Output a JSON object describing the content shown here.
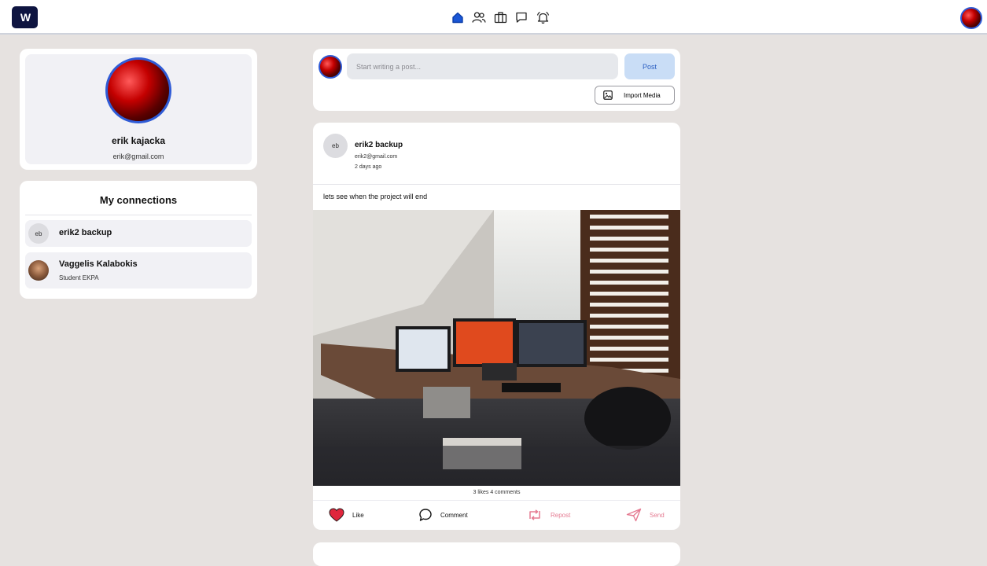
{
  "header": {
    "logo_text": "W",
    "nav": [
      {
        "icon": "home-icon",
        "active": true
      },
      {
        "icon": "people-icon"
      },
      {
        "icon": "briefcase-icon"
      },
      {
        "icon": "chat-icon"
      },
      {
        "icon": "bell-icon"
      }
    ]
  },
  "profile": {
    "name": "erik kajacka",
    "email": "erik@gmail.com"
  },
  "connections": {
    "title": "My connections",
    "items": [
      {
        "initials": "eb",
        "name": "erik2 backup",
        "subtitle": ""
      },
      {
        "initials": "",
        "name": "Vaggelis Kalabokis",
        "subtitle": "Student EKPA"
      }
    ]
  },
  "composer": {
    "placeholder": "Start writing a post...",
    "post_label": "Post",
    "import_media_label": "Import Media"
  },
  "post": {
    "initials": "eb",
    "author": "erik2 backup",
    "email": "erik2@gmail.com",
    "time": "2 days ago",
    "text": "lets see when the project will end",
    "stats": "3 likes  4 comments",
    "actions": {
      "like": "Like",
      "comment": "Comment",
      "repost": "Repost",
      "send": "Send"
    }
  },
  "colors": {
    "accent": "#2f5bd6",
    "like": "#e0263c",
    "muted_action": "#e57b92",
    "background": "#e6e2e0"
  }
}
